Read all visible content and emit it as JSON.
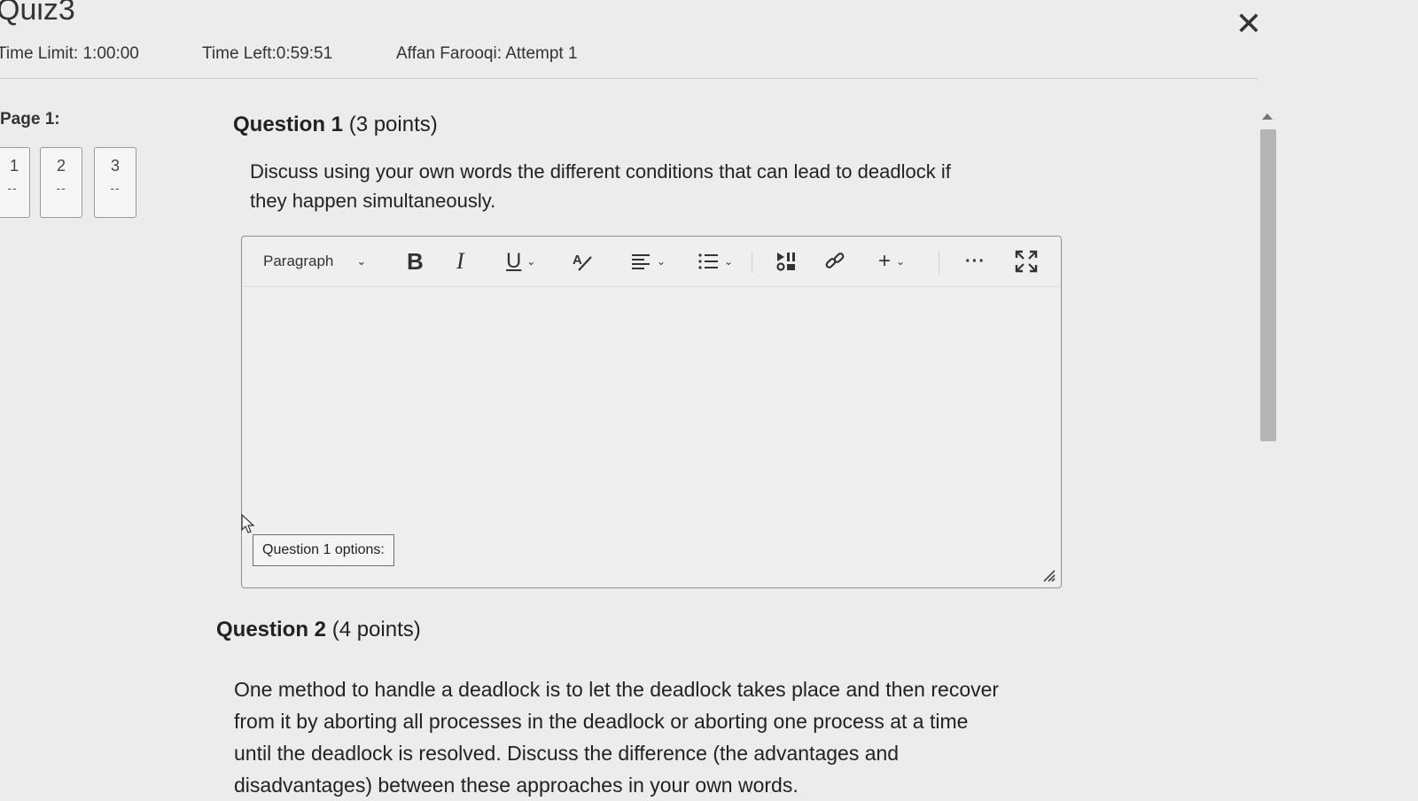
{
  "quiz": {
    "title": "Quiz3",
    "time_limit": "Time Limit: 1:00:00",
    "time_left": "Time Left:0:59:51",
    "attempt": "Affan Farooqi: Attempt 1"
  },
  "sidebar": {
    "page_label": "Page 1:",
    "questions": [
      {
        "number": "1",
        "status": "--"
      },
      {
        "number": "2",
        "status": "--"
      },
      {
        "number": "3",
        "status": "--"
      }
    ]
  },
  "questions": [
    {
      "title": "Question 1",
      "points": "(3 points)",
      "text_line1": "Discuss using your own words the different conditions that can lead to deadlock if",
      "text_line2": "they happen simultaneously."
    },
    {
      "title": "Question 2",
      "points": "(4 points)",
      "text_line1": "One method to handle a deadlock is to let the deadlock takes place and then recover",
      "text_line2": "from it by aborting all processes in the deadlock or aborting one process at a time",
      "text_line3": "until the deadlock is resolved. Discuss the difference (the advantages and",
      "text_line4": "disadvantages) between these approaches in your own words."
    }
  ],
  "editor": {
    "format_value": "Paragraph",
    "bold_label": "B",
    "italic_label": "I",
    "underline_label": "U",
    "insert_label": "+",
    "more_label": "···",
    "options_button": "Question 1 options:"
  },
  "icons": {
    "close": "close-icon",
    "format": "chevron-down-icon",
    "spell": "spellcheck-icon",
    "align": "align-left-icon",
    "list": "bullet-list-icon",
    "media": "insert-media-icon",
    "link": "link-icon",
    "fullscreen": "fullscreen-icon"
  }
}
